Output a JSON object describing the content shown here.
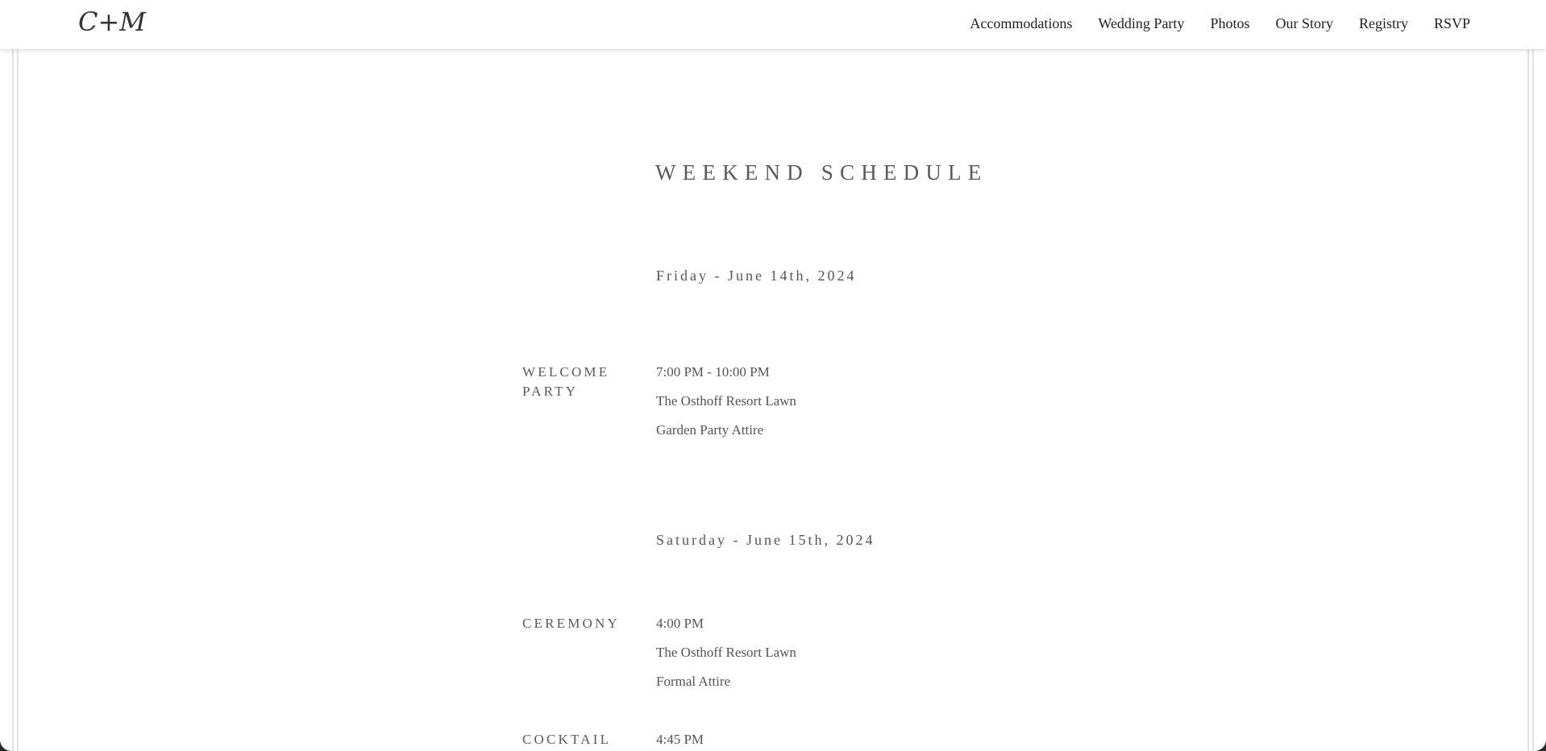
{
  "nav": {
    "logo": "C+M",
    "links": [
      "Accommodations",
      "Wedding Party",
      "Photos",
      "Our Story",
      "Registry",
      "RSVP"
    ]
  },
  "schedule": {
    "title": "WEEKEND SCHEDULE",
    "days": [
      {
        "label": "Friday - June 14th, 2024",
        "events": [
          {
            "name": "WELCOME PARTY",
            "time": "7:00 PM - 10:00 PM",
            "location": "The Osthoff Resort Lawn",
            "attire": "Garden Party Attire"
          }
        ]
      },
      {
        "label": "Saturday - June 15th, 2024",
        "events": [
          {
            "name": "CEREMONY",
            "time": "4:00 PM",
            "location": "The Osthoff Resort Lawn",
            "attire": "Formal Attire"
          },
          {
            "name": "COCKTAIL",
            "time": "4:45 PM"
          }
        ]
      }
    ]
  },
  "colors": {
    "background": "#ffffff",
    "text": "#5a5a5a",
    "nav_text": "#1f1f1f",
    "rule": "#e3e3e3"
  }
}
